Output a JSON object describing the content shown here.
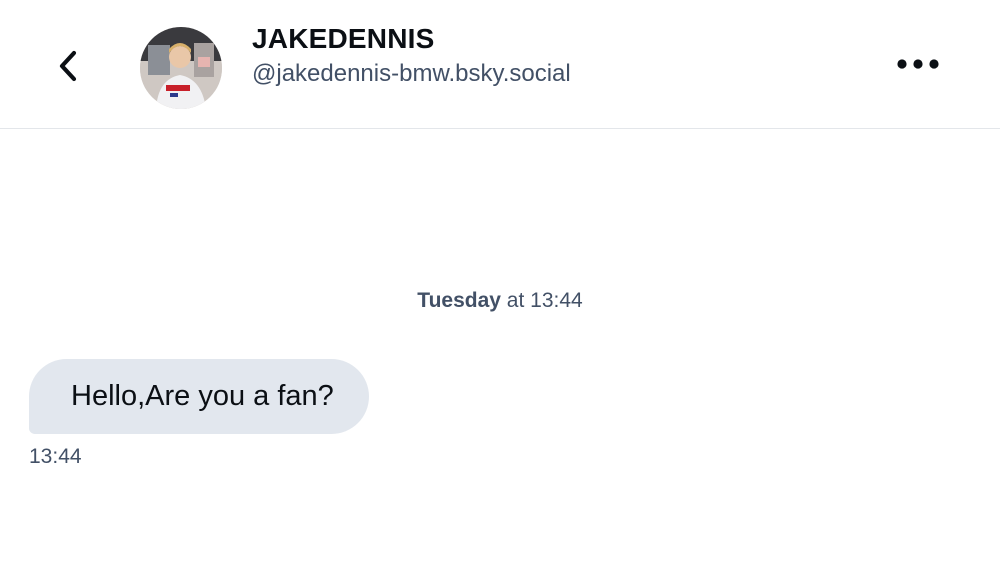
{
  "header": {
    "display_name": "JAKEDENNIS",
    "handle": "@jakedennis-bmw.bsky.social",
    "back_icon": "chevron-left-icon",
    "more_icon": "ellipsis-horizontal-icon",
    "avatar_icon": "avatar-photo"
  },
  "conversation": {
    "date_divider": {
      "day": "Tuesday",
      "rest": " at 13:44"
    },
    "messages": [
      {
        "text": "Hello,Are you a fan?",
        "time": "13:44",
        "direction": "incoming"
      }
    ]
  },
  "colors": {
    "bubble_bg": "#e2e7ee",
    "muted_text": "#425066",
    "primary_text": "#0b0f14",
    "divider": "#e3e6ea"
  }
}
